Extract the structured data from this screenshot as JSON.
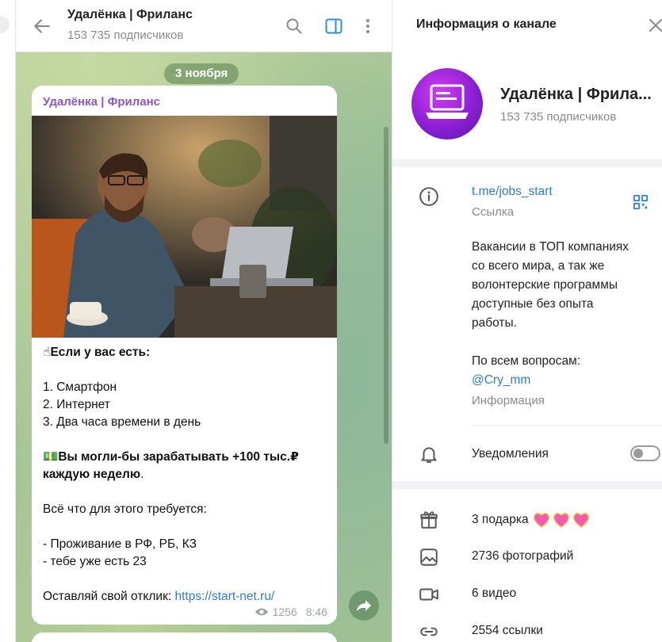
{
  "header": {
    "title": "Удалёнка | Фриланс",
    "subscribers": "153 735 подписчиков"
  },
  "chat": {
    "date": "3 ноября",
    "message": {
      "sender": "Удалёнка | Фриланс",
      "line1_emoji": "☝",
      "line1": "Если у вас есть:",
      "list1": "1. Смартфон",
      "list2": "2. Интернет",
      "list3": "3. Два часа времени в день",
      "line2_emoji": "💵",
      "line2a": "Вы могли-бы зарабатывать +100 тыс.₽",
      "line2b": "каждую неделю",
      "line2b_tail": ".",
      "line3": "Всё что для этого требуется:",
      "req1": "- Проживание в РФ, РБ, КЗ",
      "req2": "- тебе уже есть 23",
      "cta": "Оставляй свой отклик: ",
      "cta_link": "https://start-net.ru/",
      "views": "1256",
      "time": "8:46"
    }
  },
  "info": {
    "title": "Информация о канале",
    "channel_name": "Удалёнка | Фрила...",
    "subscribers": "153 735 подписчиков",
    "link": "t.me/jobs_start",
    "link_label": "Ссылка",
    "description_lines": [
      "Вакансии в ТОП компаниях",
      "со всего мира, а так же",
      "волонтерские программы",
      "доступные без опыта",
      "работы."
    ],
    "questions": "По всем вопросам:",
    "contact": "@Cry_mm",
    "info_label": "Информация",
    "notifications": "Уведомления",
    "notifications_on": false,
    "gifts": "3 подарка",
    "photos": "2736 фотографий",
    "videos": "6 видео",
    "links": "2554 ссылки"
  },
  "colors": {
    "accent": "#2f7fc7",
    "sender": "#8b56c8",
    "chat_bg": "#a3c197"
  }
}
